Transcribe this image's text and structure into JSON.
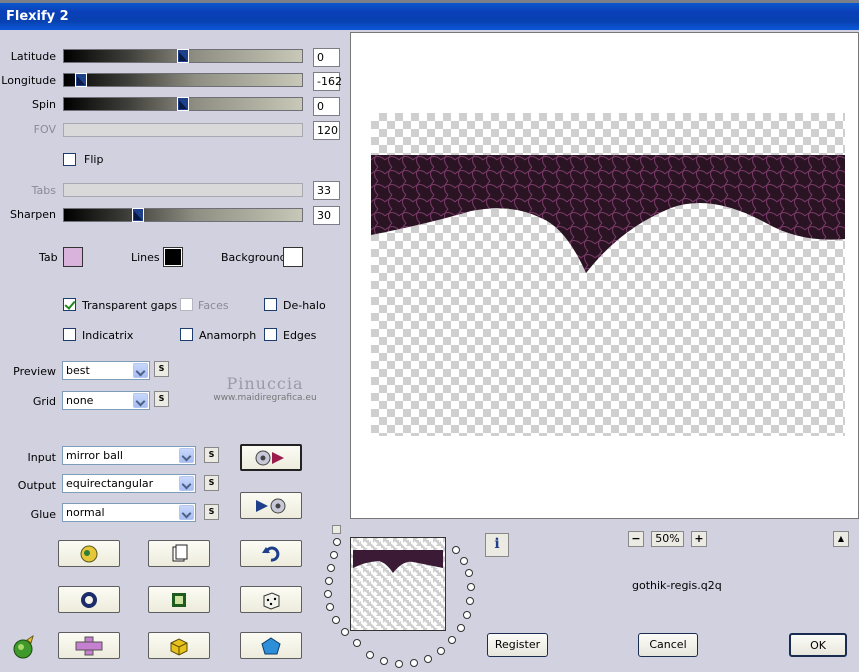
{
  "window": {
    "title": "Flexify 2"
  },
  "sliders": {
    "latitude": {
      "label": "Latitude",
      "value": "0",
      "level": 0.5
    },
    "longitude": {
      "label": "Longitude",
      "value": "-162",
      "level": 0.05
    },
    "spin": {
      "label": "Spin",
      "value": "0",
      "level": 0.5
    },
    "fov": {
      "label": "FOV",
      "value": "120",
      "enabled": false
    },
    "tabs": {
      "label": "Tabs",
      "value": "33",
      "enabled": false
    },
    "sharpen": {
      "label": "Sharpen",
      "value": "30",
      "level": 0.3
    }
  },
  "flip": {
    "label": "Flip",
    "checked": false
  },
  "colors": {
    "tab": {
      "label": "Tab",
      "color": "#d9b3dc"
    },
    "lines": {
      "label": "Lines",
      "color": "#000000"
    },
    "background": {
      "label": "Background",
      "color": "#ffffff"
    }
  },
  "options": {
    "transparent_gaps": {
      "label": "Transparent gaps",
      "checked": true
    },
    "faces": {
      "label": "Faces",
      "checked": false,
      "enabled": false
    },
    "de_halo": {
      "label": "De-halo",
      "checked": false
    },
    "indicatrix": {
      "label": "Indicatrix",
      "checked": false
    },
    "anamorph": {
      "label": "Anamorph",
      "checked": false
    },
    "edges": {
      "label": "Edges",
      "checked": false
    }
  },
  "preview_select": {
    "label": "Preview",
    "value": "best"
  },
  "grid_select": {
    "label": "Grid",
    "value": "none"
  },
  "watermark": {
    "line1": "Pinuccia",
    "line2": "www.maidiregrafica.eu"
  },
  "input_select": {
    "label": "Input",
    "value": "mirror ball"
  },
  "output_select": {
    "label": "Output",
    "value": "equirectangular"
  },
  "glue_select": {
    "label": "Glue",
    "value": "normal"
  },
  "s_button": "S",
  "zoom": {
    "minus": "−",
    "value": "50%",
    "plus": "+"
  },
  "filename": "gothik-regis.q2q",
  "buttons": {
    "register": "Register",
    "cancel": "Cancel",
    "ok": "OK"
  },
  "info_icon": "i",
  "scroll_up": "▲"
}
